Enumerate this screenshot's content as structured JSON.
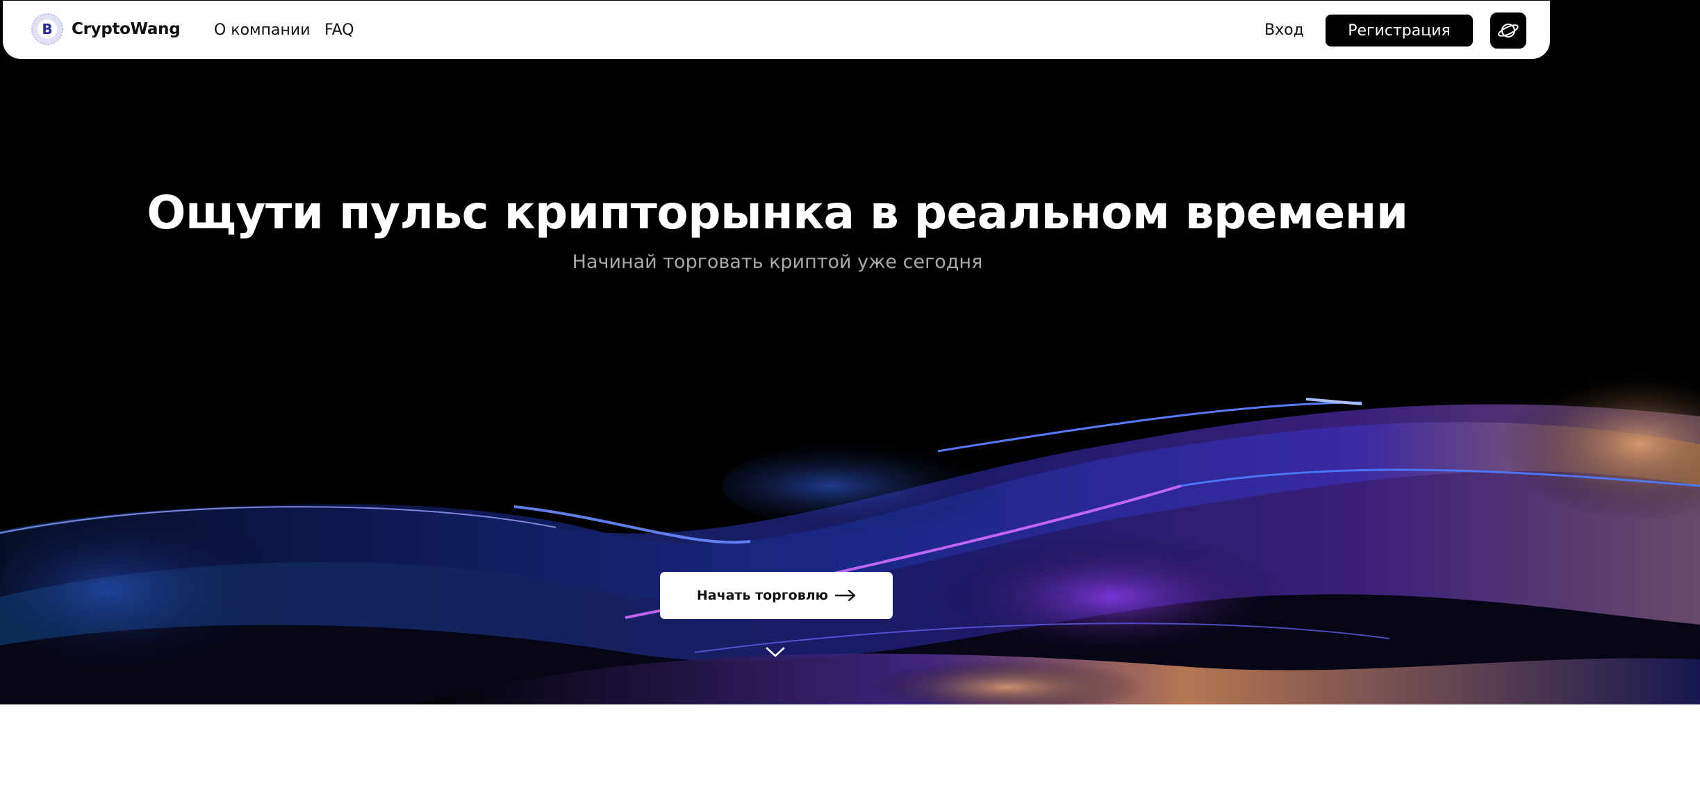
{
  "brand": {
    "name": "CryptoWang",
    "logo_icon": "bitcoin-coin-icon"
  },
  "nav": {
    "links": [
      "О компании",
      "FAQ"
    ],
    "login": "Вход",
    "register": "Регистрация",
    "language_icon": "planet-icon"
  },
  "hero": {
    "headline": "Ощути пульс крипторынка в реальном времени",
    "subheadline": "Начинай торговать криптой уже сегодня",
    "cta_label": "Начать торговлю",
    "cta_icon": "arrow-right-icon",
    "scroll_icon": "chevron-down-icon"
  },
  "colors": {
    "hero_bg": "#000000",
    "accent_blue": "#2a3cff",
    "accent_purple": "#8a3cf0",
    "accent_copper": "#c8895a"
  }
}
